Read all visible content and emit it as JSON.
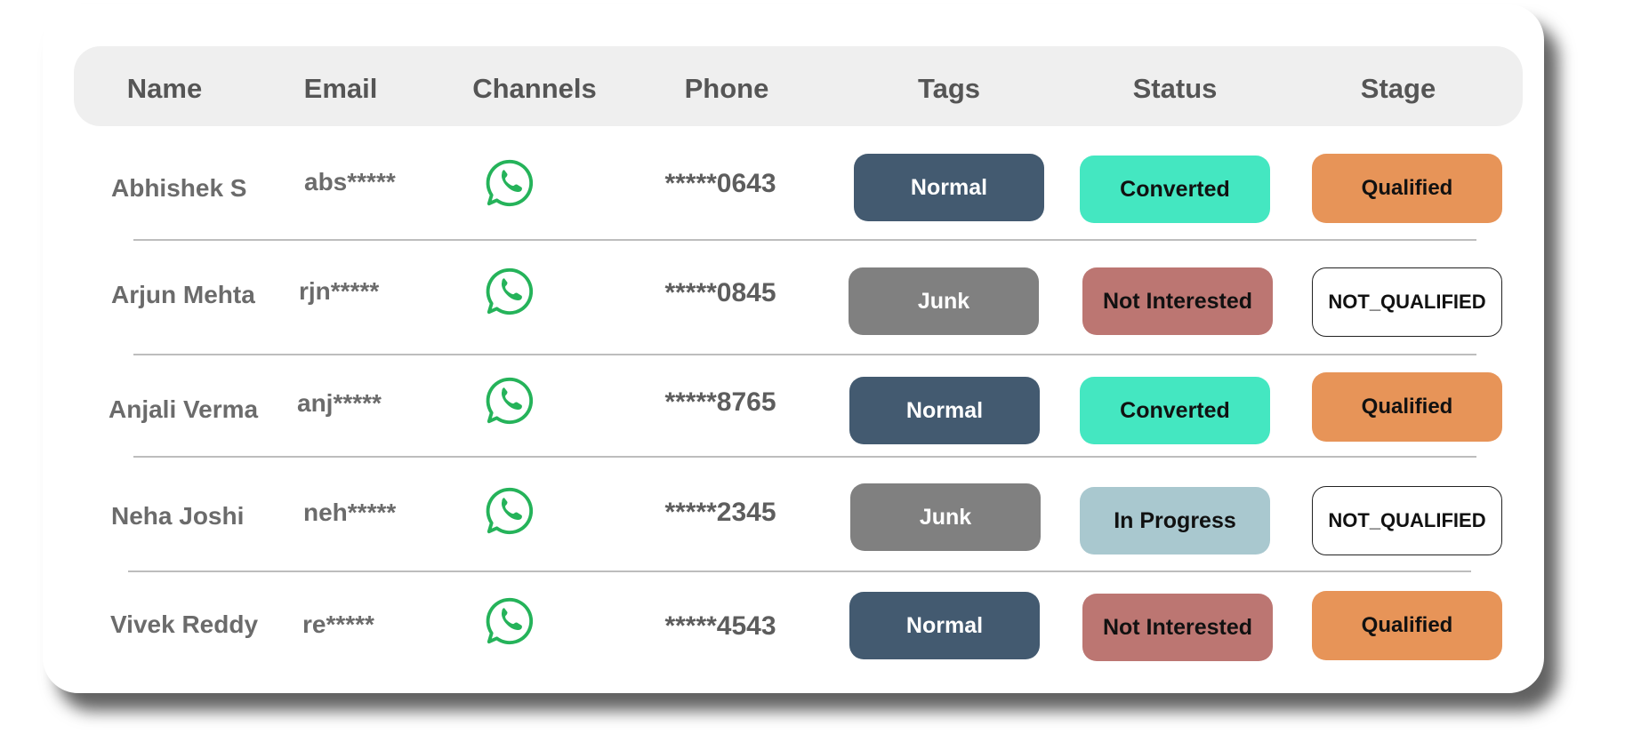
{
  "columns": {
    "name": "Name",
    "email": "Email",
    "channels": "Channels",
    "phone": "Phone",
    "tags": "Tags",
    "status": "Status",
    "stage": "Stage"
  },
  "rows": [
    {
      "name": "Abhishek S",
      "email": "abs*****",
      "channel_icon": "whatsapp-icon",
      "phone": "*****0643",
      "tag": "Normal",
      "status": "Converted",
      "stage": "Qualified"
    },
    {
      "name": "Arjun Mehta",
      "email": "rjn*****",
      "channel_icon": "whatsapp-icon",
      "phone": "*****0845",
      "tag": "Junk",
      "status": "Not Interested",
      "stage": "NOT_QUALIFIED"
    },
    {
      "name": "Anjali Verma",
      "email": "anj*****",
      "channel_icon": "whatsapp-icon",
      "phone": "*****8765",
      "tag": "Normal",
      "status": "Converted",
      "stage": "Qualified"
    },
    {
      "name": "Neha Joshi",
      "email": "neh*****",
      "channel_icon": "whatsapp-icon",
      "phone": "*****2345",
      "tag": "Junk",
      "status": "In Progress",
      "stage": "NOT_QUALIFIED"
    },
    {
      "name": "Vivek Reddy",
      "email": "re*****",
      "channel_icon": "whatsapp-icon",
      "phone": "*****4543",
      "tag": "Normal",
      "status": "Not Interested",
      "stage": "Qualified"
    }
  ],
  "colors": {
    "tag_normal": "#435a70",
    "tag_junk": "#808080",
    "status_converted": "#44e7c1",
    "status_not_interested": "#bc7672",
    "status_in_progress": "#a9c8cf",
    "stage_qualified": "#e79458",
    "whatsapp_green": "#25b35a"
  }
}
